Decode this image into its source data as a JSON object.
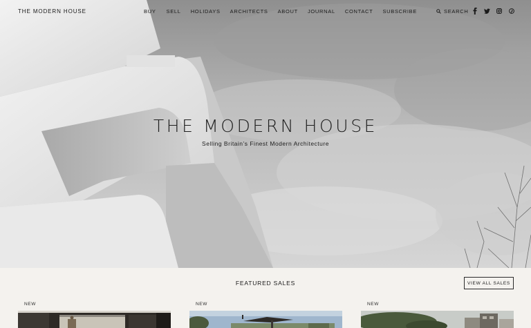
{
  "header": {
    "brand": "THE MODERN HOUSE",
    "nav": [
      {
        "label": "BUY"
      },
      {
        "label": "SELL"
      },
      {
        "label": "HOLIDAYS"
      },
      {
        "label": "ARCHITECTS"
      },
      {
        "label": "ABOUT"
      },
      {
        "label": "JOURNAL"
      },
      {
        "label": "CONTACT"
      },
      {
        "label": "SUBSCRIBE"
      }
    ],
    "search_label": "SEARCH",
    "social": [
      "facebook-icon",
      "twitter-icon",
      "instagram-icon",
      "pinterest-icon"
    ]
  },
  "hero": {
    "title": "THE MODERN HOUSE",
    "subtitle": "Selling Britain’s Finest Modern Architecture"
  },
  "featured": {
    "title": "FEATURED SALES",
    "view_all": "VIEW ALL SALES",
    "cards": [
      {
        "badge": "NEW"
      },
      {
        "badge": "NEW"
      },
      {
        "badge": "NEW"
      }
    ]
  }
}
